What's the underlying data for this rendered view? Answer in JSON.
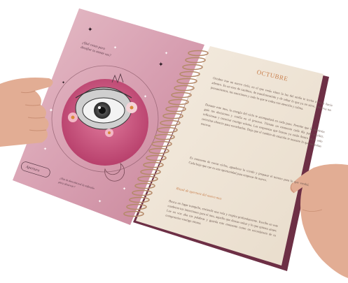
{
  "left_page": {
    "question": "¿Qué cosas para desafiar tu mente ves?",
    "button_label": "Apertura",
    "footer_note": "¿Has la desvolecerá la reflexión para observar?",
    "background_color": "#d9a6b6",
    "circle_color": "#c9507a"
  },
  "right_page": {
    "month_title": "OCTUBRE",
    "paragraph_1": "Octubre trae un nuevo ciclo, en el que verás cómo la luz del otoño te invita a mirar hacia adentro. Es un mes de cambios, de transformación y de soltar lo que ya no sirve. Observa tus pensamientos, tus emociones y todo lo que te rodea con atención y calma.",
    "paragraph_2": "Durante este mes, la energía del ciclo te acompañará en cada paso. Permite que la intuición guíe tus decisiones y confía en el proceso. Tómate un momento cada día para escribir, reflexionar y conectar contigo misma. Las respuestas que buscas ya están dentro de ti; solo necesitas silencio para escucharlas. Deja que el cambio de estación te muestre lo que necesitas renovar.",
    "paragraph_3": "Es momento de cerrar ciclos, agradecer lo vivido y preparar el terreno para lo que vendrá. Cada hoja que cae es una oportunidad para empezar de nuevo.",
    "subheading": "Ritual de apertura del nuevo mes",
    "paragraph_4": "Busca un lugar tranquilo, enciende una vela y respira profundamente. Escribe en este cuaderno tus intenciones para el mes, aquello que deseas soltar y lo que quieres atraer. Lee en voz alta tus palabras y guarda este momento como un recordatorio de tu compromiso contigo misma.",
    "paper_color": "#efe4d6",
    "accent_color": "#c9804e"
  },
  "colors": {
    "skin": "#e8b9a0",
    "skin_shadow": "#c98f74",
    "spiral": "#b58a6a"
  }
}
